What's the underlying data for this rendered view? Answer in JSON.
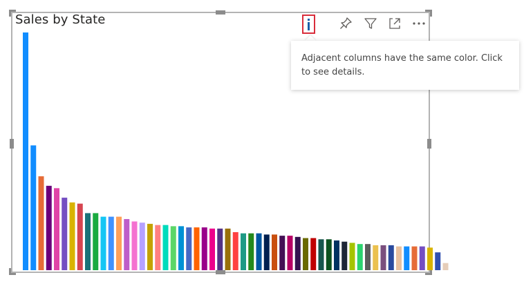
{
  "visual": {
    "title": "Sales by State",
    "info_tooltip": "Adjacent columns have the same color. Click to see details."
  },
  "header_icons": {
    "info": "info-icon",
    "pin": "pin-icon",
    "filter": "filter-icon",
    "focus": "focus-mode-icon",
    "more": "more-options-icon"
  },
  "colors": {
    "frame": "#b3b3b3",
    "handle": "#8c8c8c",
    "info_highlight": "#d92c3a",
    "info_glyph": "#1b5ea8"
  },
  "chart_data": {
    "type": "bar",
    "title": "Sales by State",
    "xlabel": "",
    "ylabel": "",
    "axis_labels_shown": false,
    "grid": false,
    "legend": "none",
    "ylim": [
      0,
      100
    ],
    "values": [
      100,
      52.5,
      39.5,
      35.5,
      34.5,
      30.5,
      28.5,
      28,
      24,
      24,
      22.5,
      22.5,
      22.5,
      21.5,
      20.5,
      20,
      19.5,
      19,
      19,
      18.5,
      18.5,
      18,
      18,
      18,
      17.5,
      17.5,
      17.5,
      16,
      15.5,
      15.5,
      15.5,
      15,
      15,
      14.5,
      14.5,
      14,
      13.5,
      13.5,
      13,
      13,
      12.5,
      12,
      11.5,
      11,
      11,
      10.5,
      10.5,
      10.5,
      10,
      10,
      10,
      10,
      9.5,
      7.5,
      3
    ],
    "colors": [
      "#118dff",
      "#118dff",
      "#e66c37",
      "#6b007b",
      "#e044a7",
      "#744ec2",
      "#d9b300",
      "#d64550",
      "#197278",
      "#1aab40",
      "#15c6f4",
      "#4092ff",
      "#ffa058",
      "#be5dc9",
      "#f472d0",
      "#b5a1ff",
      "#c4a200",
      "#ff8080",
      "#00dbbc",
      "#5bd667",
      "#0091d5",
      "#4668c5",
      "#ff6300",
      "#99008a",
      "#ec008c",
      "#533285",
      "#99700a",
      "#ff4141",
      "#1f9a85",
      "#25891c",
      "#0057a2",
      "#002050",
      "#c94f0f",
      "#450f54",
      "#b60064",
      "#34124f",
      "#6a6a00",
      "#c00000",
      "#16564d",
      "#0b511f",
      "#003261",
      "#1e2636",
      "#a4c400",
      "#2bd36f",
      "#5c5c5c",
      "#ebc14f",
      "#7a4f7e",
      "#2a4a9e",
      "#e8c1a0",
      "#118dff",
      "#e66c37",
      "#744ec2",
      "#d9b300",
      "#3050b0",
      "#e6cdb8"
    ]
  }
}
